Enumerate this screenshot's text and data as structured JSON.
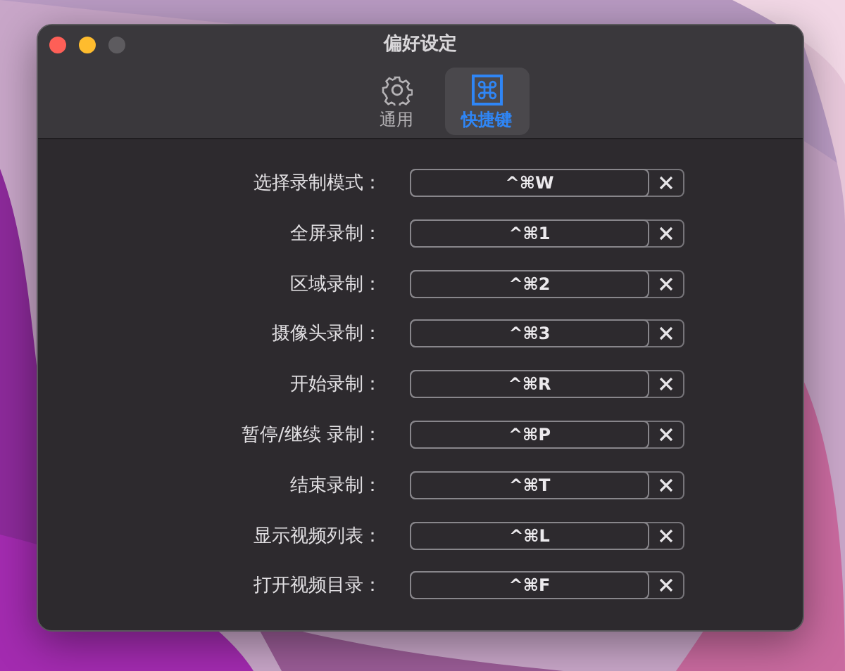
{
  "window": {
    "title": "偏好设定"
  },
  "tabs": [
    {
      "label": "通用",
      "kind": "gear",
      "selected": false
    },
    {
      "label": "快捷键",
      "kind": "command",
      "selected": true
    }
  ],
  "shortcuts": [
    {
      "label": "选择录制模式：",
      "value": "^⌘W"
    },
    {
      "label": "全屏录制：",
      "value": "^⌘1"
    },
    {
      "label": "区域录制：",
      "value": "^⌘2"
    },
    {
      "label": "摄像头录制：",
      "value": "^⌘3"
    },
    {
      "label": "开始录制：",
      "value": "^⌘R"
    },
    {
      "label": "暂停/继续 录制：",
      "value": "^⌘P"
    },
    {
      "label": "结束录制：",
      "value": "^⌘T"
    },
    {
      "label": "显示视频列表：",
      "value": "^⌘L"
    },
    {
      "label": "打开视频目录：",
      "value": "^⌘F"
    }
  ]
}
